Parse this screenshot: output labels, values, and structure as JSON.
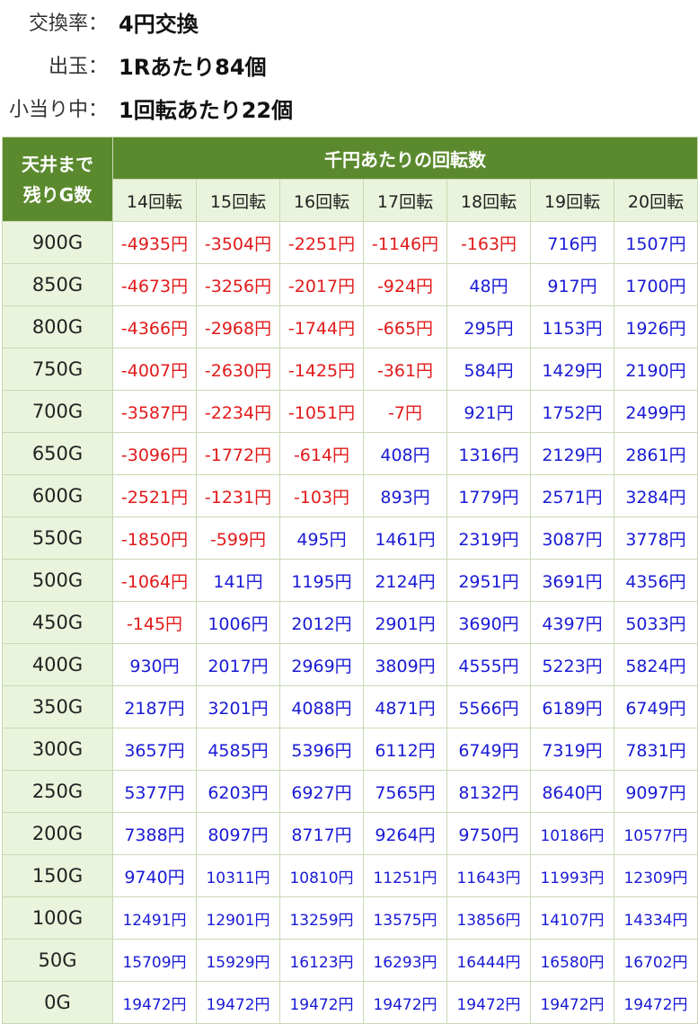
{
  "info": [
    {
      "label": "交換率：",
      "value": "4円交換"
    },
    {
      "label": "出玉：",
      "value": "1Rあたり84個"
    },
    {
      "label": "小当り中：",
      "value": "1回転あたり22個"
    }
  ],
  "table": {
    "corner": [
      "天井まで",
      "残りG数"
    ],
    "super_header": "千円あたりの回転数",
    "columns": [
      "14回転",
      "15回転",
      "16回転",
      "17回転",
      "18回転",
      "19回転",
      "20回転"
    ],
    "rows": [
      {
        "label": "900G",
        "values": [
          "-4935円",
          "-3504円",
          "-2251円",
          "-1146円",
          "-163円",
          "716円",
          "1507円"
        ]
      },
      {
        "label": "850G",
        "values": [
          "-4673円",
          "-3256円",
          "-2017円",
          "-924円",
          "48円",
          "917円",
          "1700円"
        ]
      },
      {
        "label": "800G",
        "values": [
          "-4366円",
          "-2968円",
          "-1744円",
          "-665円",
          "295円",
          "1153円",
          "1926円"
        ]
      },
      {
        "label": "750G",
        "values": [
          "-4007円",
          "-2630円",
          "-1425円",
          "-361円",
          "584円",
          "1429円",
          "2190円"
        ]
      },
      {
        "label": "700G",
        "values": [
          "-3587円",
          "-2234円",
          "-1051円",
          "-7円",
          "921円",
          "1752円",
          "2499円"
        ]
      },
      {
        "label": "650G",
        "values": [
          "-3096円",
          "-1772円",
          "-614円",
          "408円",
          "1316円",
          "2129円",
          "2861円"
        ]
      },
      {
        "label": "600G",
        "values": [
          "-2521円",
          "-1231円",
          "-103円",
          "893円",
          "1779円",
          "2571円",
          "3284円"
        ]
      },
      {
        "label": "550G",
        "values": [
          "-1850円",
          "-599円",
          "495円",
          "1461円",
          "2319円",
          "3087円",
          "3778円"
        ]
      },
      {
        "label": "500G",
        "values": [
          "-1064円",
          "141円",
          "1195円",
          "2124円",
          "2951円",
          "3691円",
          "4356円"
        ]
      },
      {
        "label": "450G",
        "values": [
          "-145円",
          "1006円",
          "2012円",
          "2901円",
          "3690円",
          "4397円",
          "5033円"
        ]
      },
      {
        "label": "400G",
        "values": [
          "930円",
          "2017円",
          "2969円",
          "3809円",
          "4555円",
          "5223円",
          "5824円"
        ]
      },
      {
        "label": "350G",
        "values": [
          "2187円",
          "3201円",
          "4088円",
          "4871円",
          "5566円",
          "6189円",
          "6749円"
        ]
      },
      {
        "label": "300G",
        "values": [
          "3657円",
          "4585円",
          "5396円",
          "6112円",
          "6749円",
          "7319円",
          "7831円"
        ]
      },
      {
        "label": "250G",
        "values": [
          "5377円",
          "6203円",
          "6927円",
          "7565円",
          "8132円",
          "8640円",
          "9097円"
        ]
      },
      {
        "label": "200G",
        "values": [
          "7388円",
          "8097円",
          "8717円",
          "9264円",
          "9750円",
          "10186円",
          "10577円"
        ]
      },
      {
        "label": "150G",
        "values": [
          "9740円",
          "10311円",
          "10810円",
          "11251円",
          "11643円",
          "11993円",
          "12309円"
        ]
      },
      {
        "label": "100G",
        "values": [
          "12491円",
          "12901円",
          "13259円",
          "13575円",
          "13856円",
          "14107円",
          "14334円"
        ]
      },
      {
        "label": "50G",
        "values": [
          "15709円",
          "15929円",
          "16123円",
          "16293円",
          "16444円",
          "16580円",
          "16702円"
        ]
      },
      {
        "label": "0G",
        "values": [
          "19472円",
          "19472円",
          "19472円",
          "19472円",
          "19472円",
          "19472円",
          "19472円"
        ]
      }
    ]
  },
  "colors": {
    "header_green": "#5b8a2e",
    "light_green": "#eaf4dc",
    "negative": "#e21a1a",
    "positive": "#1a1ad6"
  }
}
